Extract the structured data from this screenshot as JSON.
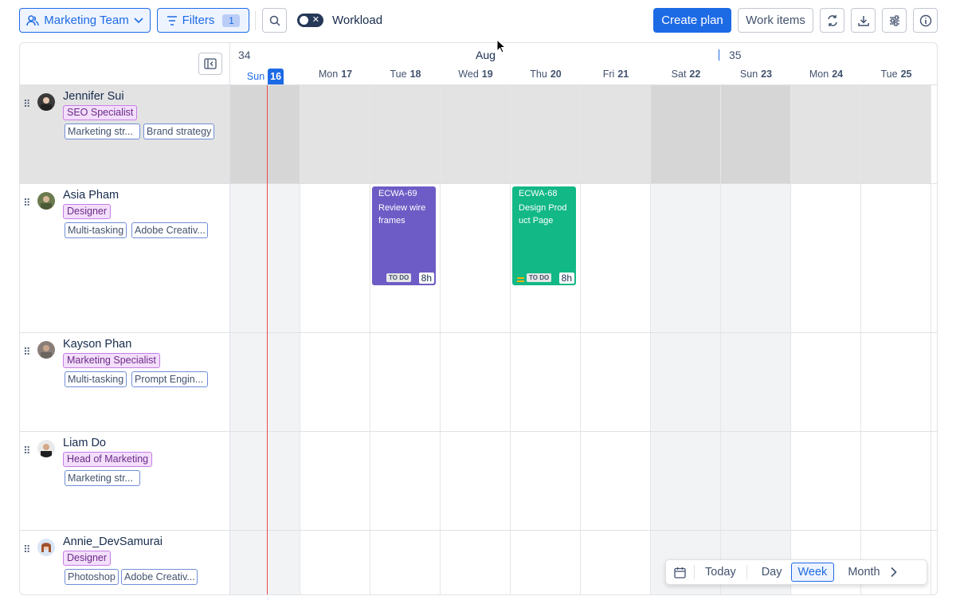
{
  "toolbar": {
    "team_label": "Marketing Team",
    "filters_label": "Filters",
    "filters_count": "1",
    "workload_label": "Workload",
    "create_plan_label": "Create plan",
    "work_items_label": "Work items"
  },
  "colors": {
    "accent": "#1d6ae5",
    "today_line": "#e84b4b",
    "task_purple": "#6e5cc6",
    "task_green": "#12b886"
  },
  "calendar": {
    "month": "Aug",
    "week_start": "34",
    "week_next": "35",
    "days": [
      {
        "name": "Sun",
        "num": "16"
      },
      {
        "name": "Mon",
        "num": "17"
      },
      {
        "name": "Tue",
        "num": "18"
      },
      {
        "name": "Wed",
        "num": "19"
      },
      {
        "name": "Thu",
        "num": "20"
      },
      {
        "name": "Fri",
        "num": "21"
      },
      {
        "name": "Sat",
        "num": "22"
      },
      {
        "name": "Sun",
        "num": "23"
      },
      {
        "name": "Mon",
        "num": "24"
      },
      {
        "name": "Tue",
        "num": "25"
      }
    ]
  },
  "people": [
    {
      "name": "Jennifer Sui",
      "role": "SEO Specialist",
      "skills": [
        "Marketing str...",
        "Brand strategy"
      ]
    },
    {
      "name": "Asia Pham",
      "role": "Designer",
      "skills": [
        "Multi-tasking",
        "Adobe Creativ..."
      ]
    },
    {
      "name": "Kayson Phan",
      "role": "Marketing Specialist",
      "skills": [
        "Multi-tasking",
        "Prompt Engin..."
      ]
    },
    {
      "name": "Liam Do",
      "role": "Head of Marketing",
      "skills": [
        "Marketing str..."
      ]
    },
    {
      "name": "Annie_DevSamurai",
      "role": "Designer",
      "skills": [
        "Photoshop",
        "Adobe Creativ..."
      ]
    }
  ],
  "tasks": [
    {
      "key": "ECWA-69",
      "title": "Review wire frames",
      "status": "TO DO",
      "estimate": "8h"
    },
    {
      "key": "ECWA-68",
      "title": "Design Prod uct Page",
      "status": "TO DO",
      "estimate": "8h"
    }
  ],
  "nav": {
    "today": "Today",
    "day": "Day",
    "week": "Week",
    "month": "Month"
  }
}
